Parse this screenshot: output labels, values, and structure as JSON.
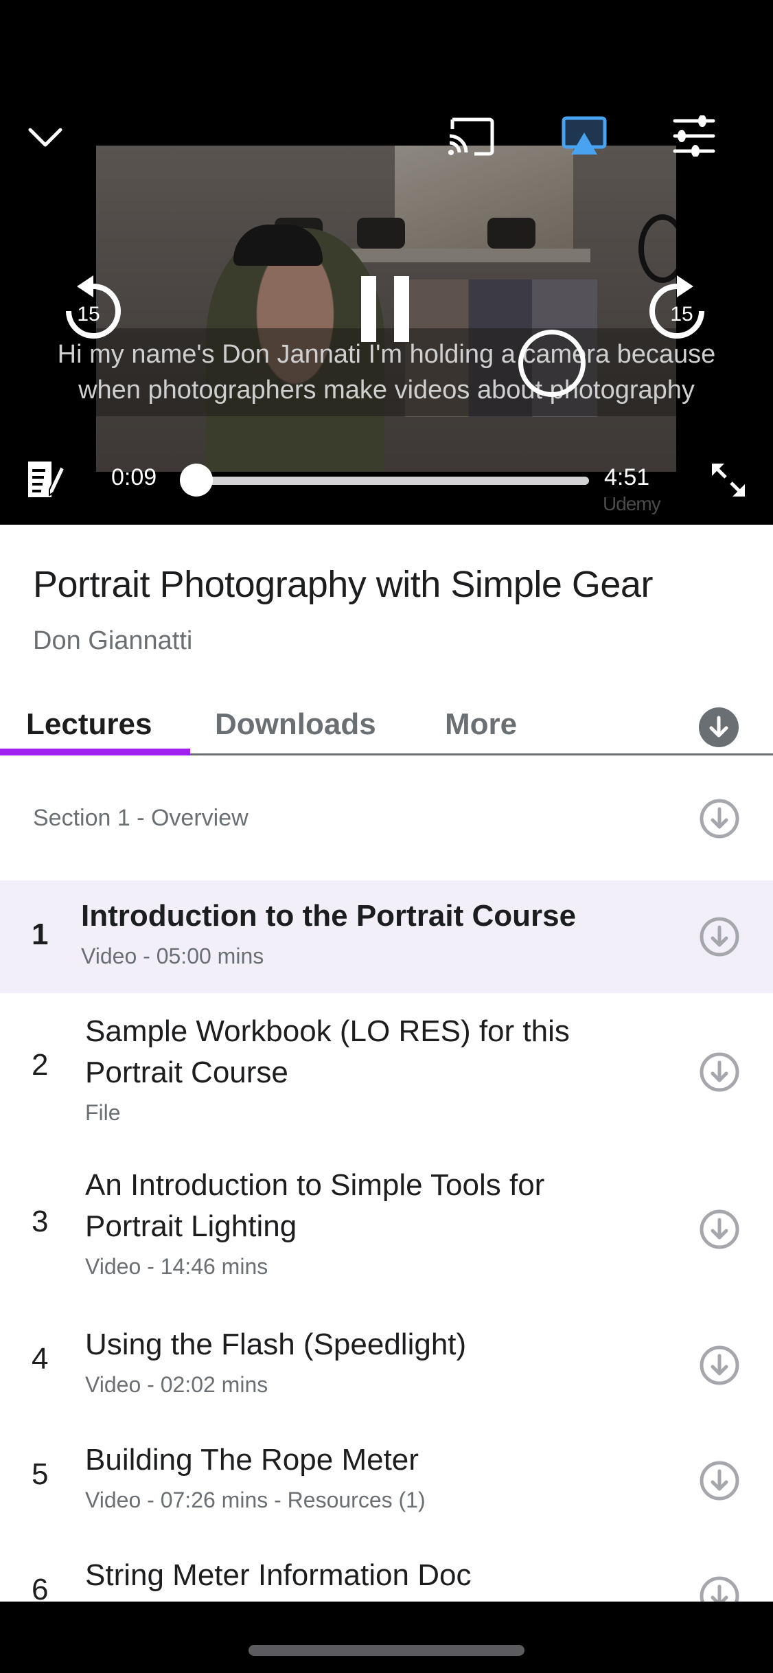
{
  "player": {
    "caption_line1": "Hi my name's Don Jannati I'm holding a camera because",
    "caption_line2": "when photographers make videos about photography",
    "current_time": "0:09",
    "duration": "4:51",
    "progress_fraction": 0.031,
    "skip_back_seconds": "15",
    "skip_forward_seconds": "15",
    "watermark": "Udemy",
    "state": "playing",
    "accent_color": "#a020f0",
    "airplay_color": "#4aa3f0",
    "icons": {
      "collapse": "chevron-down-icon",
      "cast": "cast-icon",
      "airplay": "airplay-icon",
      "settings": "sliders-icon",
      "rewind": "rewind-15-icon",
      "forward": "forward-15-icon",
      "pause": "pause-icon",
      "notes": "notes-icon",
      "fullscreen": "fullscreen-icon"
    }
  },
  "course": {
    "title": "Portrait Photography with Simple Gear",
    "instructor": "Don Giannatti"
  },
  "tabs": [
    {
      "label": "Lectures",
      "active": true
    },
    {
      "label": "Downloads",
      "active": false
    },
    {
      "label": "More",
      "active": false
    }
  ],
  "section": {
    "title": "Section 1 - Overview"
  },
  "lectures": [
    {
      "number": "1",
      "title": "Introduction to the Portrait Course",
      "meta": "Video - 05:00 mins",
      "current": true
    },
    {
      "number": "2",
      "title": "Sample Workbook (LO RES) for this Portrait Course",
      "meta": "File",
      "current": false
    },
    {
      "number": "3",
      "title": "An Introduction to Simple Tools for Portrait Lighting",
      "meta": "Video - 14:46 mins",
      "current": false
    },
    {
      "number": "4",
      "title": "Using the Flash (Speedlight)",
      "meta": "Video - 02:02 mins",
      "current": false
    },
    {
      "number": "5",
      "title": "Building The Rope Meter",
      "meta": "Video - 07:26 mins - Resources (1)",
      "current": false
    },
    {
      "number": "6",
      "title": "String Meter Information Doc",
      "meta": "",
      "current": false
    }
  ]
}
